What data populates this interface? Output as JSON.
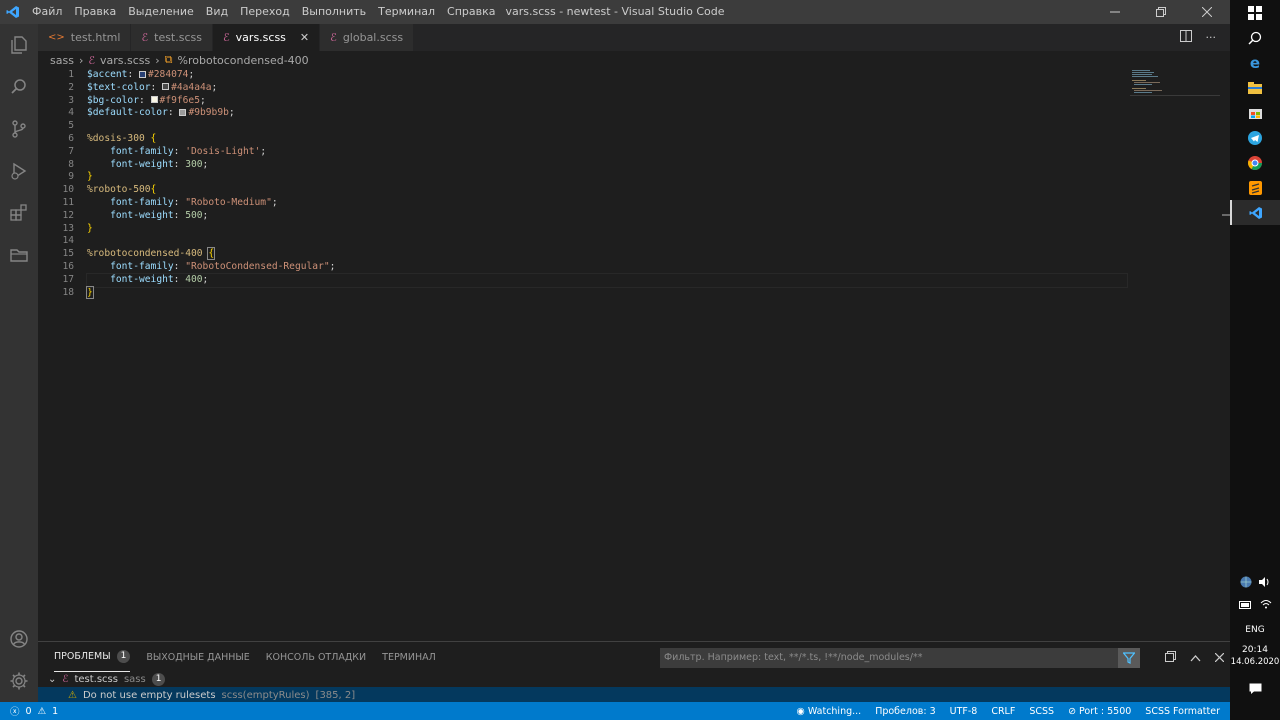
{
  "window": {
    "title": "vars.scss - newtest - Visual Studio Code",
    "menu": [
      "Файл",
      "Правка",
      "Выделение",
      "Вид",
      "Переход",
      "Выполнить",
      "Терминал",
      "Справка"
    ]
  },
  "tabs": [
    {
      "label": "test.html",
      "icon": "html-file-icon",
      "active": false
    },
    {
      "label": "test.scss",
      "icon": "sass-file-icon",
      "active": false
    },
    {
      "label": "vars.scss",
      "icon": "sass-file-icon",
      "active": true
    },
    {
      "label": "global.scss",
      "icon": "sass-file-icon",
      "active": false
    }
  ],
  "breadcrumb": {
    "folder": "sass",
    "file": "vars.scss",
    "symbol": "%robotocondensed-400"
  },
  "editor": {
    "line_numbers": [
      "1",
      "2",
      "3",
      "4",
      "5",
      "6",
      "7",
      "8",
      "9",
      "10",
      "11",
      "12",
      "13",
      "14",
      "15",
      "16",
      "17",
      "18"
    ],
    "vars": [
      {
        "name": "$accent",
        "value": "#284074"
      },
      {
        "name": "$text-color",
        "value": "#4a4a4a"
      },
      {
        "name": "$bg-color",
        "value": "#f9f6e5"
      },
      {
        "name": "$default-color",
        "value": "#9b9b9b"
      }
    ],
    "blocks": [
      {
        "selector": "%dosis-300",
        "family": "'Dosis-Light'",
        "weight": "300"
      },
      {
        "selector": "%roboto-500",
        "family": "\"Roboto-Medium\"",
        "weight": "500"
      },
      {
        "selector": "%robotocondensed-400",
        "family": "\"RobotoCondensed-Regular\"",
        "weight": "400"
      }
    ],
    "prop_family": "font-family",
    "prop_weight": "font-weight"
  },
  "panel": {
    "tabs": [
      {
        "label": "ПРОБЛЕМЫ",
        "badge": "1",
        "active": true
      },
      {
        "label": "ВЫХОДНЫЕ ДАННЫЕ"
      },
      {
        "label": "КОНСОЛЬ ОТЛАДКИ"
      },
      {
        "label": "ТЕРМИНАЛ"
      }
    ],
    "filter_placeholder": "Фильтр. Например: text, **/*.ts, !**/node_modules/**",
    "problem_file": {
      "name": "test.scss",
      "folder": "sass",
      "count": "1"
    },
    "problem": {
      "message": "Do not use empty rulesets",
      "source": "scss(emptyRules)",
      "location": "[385, 2]"
    }
  },
  "statusbar": {
    "errors": "0",
    "warnings": "1",
    "watching": "Watching...",
    "spaces": "Пробелов: 3",
    "encoding": "UTF-8",
    "eol": "CRLF",
    "language": "SCSS",
    "port": "Port : 5500",
    "formatter": "SCSS Formatter"
  },
  "taskbar": {
    "lang": "ENG",
    "time": "20:14",
    "date": "14.06.2020"
  },
  "colors": {
    "accent": "#007acc",
    "titlebar": "#3c3c3c",
    "editor_bg": "#1e1e1e"
  }
}
